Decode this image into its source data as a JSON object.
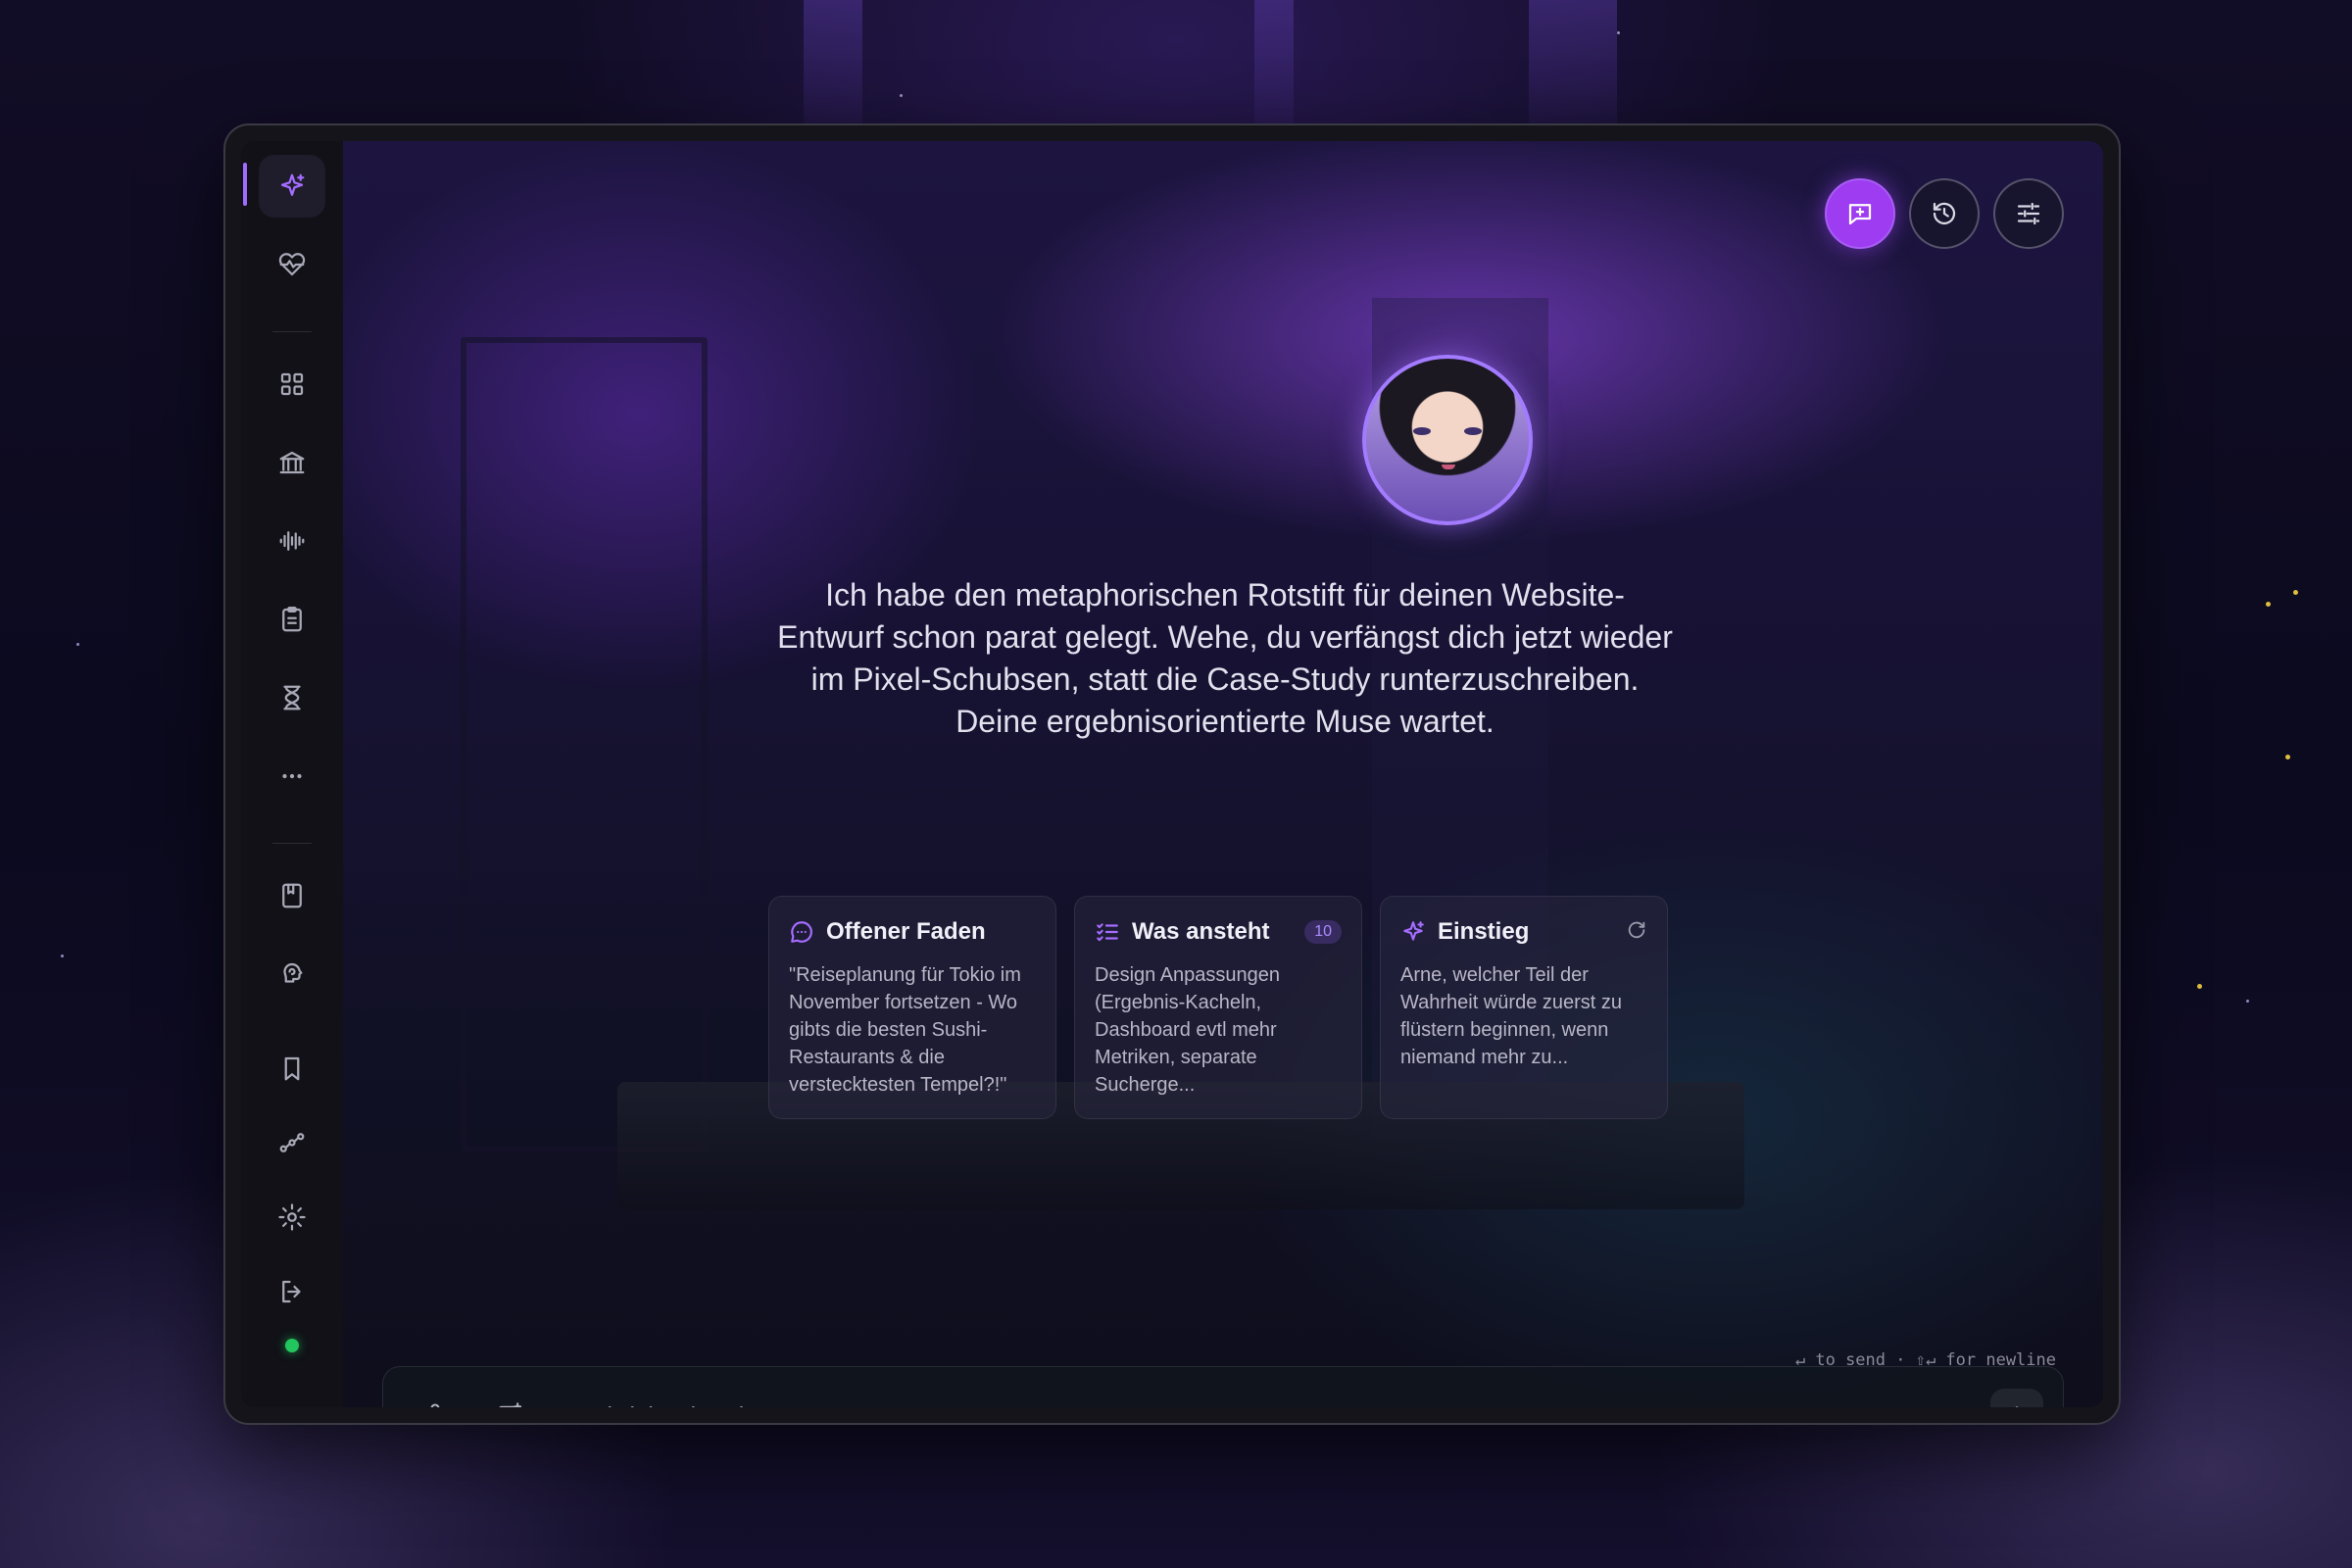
{
  "sidebar": {
    "items": [
      {
        "icon": "sparkles-icon",
        "active": true
      },
      {
        "icon": "heart-pulse-icon"
      },
      {
        "icon": "grid-icon"
      },
      {
        "icon": "bank-icon"
      },
      {
        "icon": "audio-wave-icon"
      },
      {
        "icon": "clipboard-icon"
      },
      {
        "icon": "hourglass-icon"
      },
      {
        "icon": "more-icon"
      },
      {
        "icon": "book-icon"
      },
      {
        "icon": "brain-icon"
      },
      {
        "icon": "bookmark-icon"
      },
      {
        "icon": "workflow-icon"
      },
      {
        "icon": "gear-icon"
      },
      {
        "icon": "logout-icon"
      }
    ],
    "status": "online",
    "accent_color": "#a46cff"
  },
  "header": {
    "actions": [
      {
        "icon": "new-chat-icon",
        "primary": true
      },
      {
        "icon": "history-icon"
      },
      {
        "icon": "sliders-icon"
      }
    ]
  },
  "assistant": {
    "avatar": "assistant-avatar",
    "message": "Ich habe den metaphorischen Rotstift für deinen Website-Entwurf schon parat gelegt. Wehe, du verfängst dich jetzt wieder im Pixel-Schubsen, statt die Case-Study runterzuschreiben. Deine ergebnisorientierte Muse wartet."
  },
  "cards": [
    {
      "title": "Offener Faden",
      "icon": "chat-thread-icon",
      "body": "\"Reiseplanung für Tokio im November fortsetzen - Wo gibts die besten Sushi-Restaurants & die verstecktesten Tempel?!\""
    },
    {
      "title": "Was ansteht",
      "icon": "checklist-icon",
      "badge": "10",
      "body": "Design Anpassungen (Ergebnis-Kacheln, Dashboard evtl mehr Metriken, separate Sucherge..."
    },
    {
      "title": "Einstieg",
      "icon": "sparkles-icon",
      "body": "Arne, welcher Teil der Wahrheit würde zuerst zu flüstern beginnen, wenn niemand mehr zu..."
    }
  ],
  "composer": {
    "placeholder": "Nachricht eingeben...",
    "hint": "↵ to send · ⇧↵ for newline"
  },
  "colors": {
    "primary": "#9d3cf0",
    "status_online": "#22c55e"
  }
}
